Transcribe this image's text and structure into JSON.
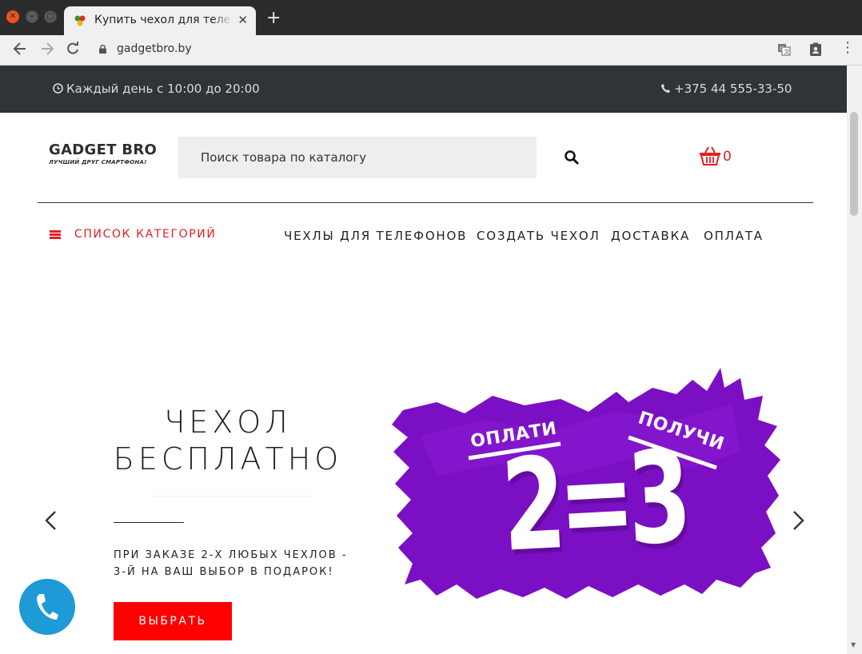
{
  "browser": {
    "tab_title": "Купить чехол для телефона",
    "tab_close": "✕",
    "new_tab": "+",
    "url": "gadgetbro.by",
    "icons": [
      "back-arrow-icon",
      "forward-arrow-icon",
      "reload-icon",
      "lock-icon",
      "translate-icon",
      "extension-icon",
      "menu-dots-icon"
    ]
  },
  "topbar": {
    "hours": "Каждый день с 10:00 до 20:00",
    "phone": "+375 44 555-33-50",
    "bg_color": "#2e3437"
  },
  "header": {
    "logo_name": "GADGET BRO",
    "logo_tagline": "ЛУЧШИЙ ДРУГ СМАРТФОНА!",
    "search_placeholder": "Поиск товара по каталогу",
    "cart_count": "0",
    "accent_color": "#e31e24"
  },
  "nav": {
    "categories_label": "СПИСОК КАТЕГОРИЙ",
    "items": [
      "ЧЕХЛЫ ДЛЯ ТЕЛЕФОНОВ",
      "СОЗДАТЬ ЧЕХОЛ",
      "ДОСТАВКА",
      "ОПЛАТА"
    ]
  },
  "hero": {
    "title_line1": "ЧЕХОЛ",
    "title_line2": "БЕСПЛАТНО",
    "text_line1": "ПРИ ЗАКАЗЕ 2-Х ЛЮБЫХ ЧЕХЛОВ -",
    "text_line2": "3-Й НА ВАШ ВЫБОР В ПОДАРОК!",
    "button_label": "ВЫБРАТЬ",
    "button_color": "#ff0000",
    "promo_left": "ОПЛАТИ",
    "promo_right": "ПОЛУЧИ",
    "promo_equation": "2=3",
    "promo_color": "#7a0fc4"
  },
  "widgets": {
    "call_button_color": "#1e9ad6"
  }
}
